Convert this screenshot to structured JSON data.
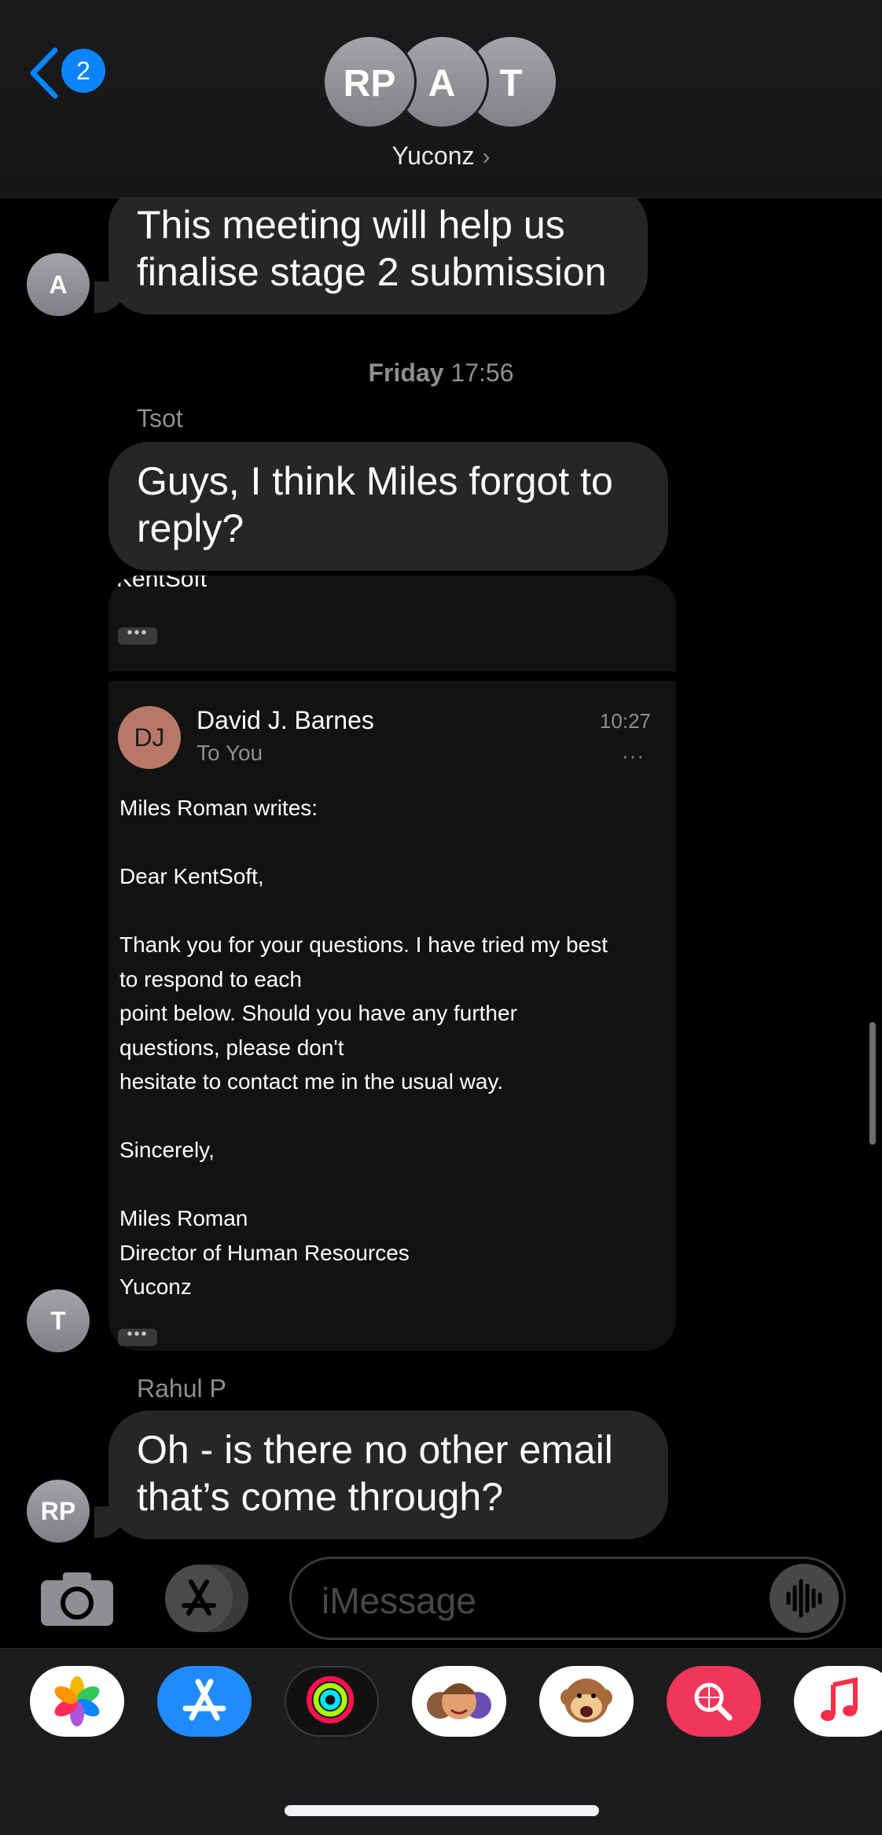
{
  "header": {
    "back_badge": "2",
    "avatars": [
      "RP",
      "A",
      "T"
    ],
    "group_name": "Yuconz",
    "chevron": "›"
  },
  "messages": {
    "first": {
      "avatar": "A",
      "line1": "This meeting will help us",
      "line2": "finalise stage 2 submission"
    },
    "timestamp": {
      "day": "Friday",
      "time": "17:56"
    },
    "tsot": {
      "sender": "Tsot",
      "line1": "Guys, I think Miles forgot to",
      "line2": "reply?"
    },
    "email_card": {
      "avatar": "T",
      "top_fragment": "KentSoft",
      "more_dots": "•••",
      "from_initials": "DJ",
      "from_name": "David J. Barnes",
      "to": "To You",
      "time": "10:27",
      "menu": "···",
      "body": {
        "l1": "Miles Roman writes:",
        "l2": "Dear KentSoft,",
        "l3": "Thank you for your questions. I have tried my best",
        "l4": "to respond to each",
        "l5": "point below. Should you have any further",
        "l6": "questions, please don't",
        "l7": "hesitate to contact me in the usual way.",
        "l8": "Sincerely,",
        "l9": "Miles Roman",
        "l10": "Director of Human Resources",
        "l11": "Yuconz"
      }
    },
    "rahul": {
      "sender": "Rahul P",
      "avatar": "RP",
      "line1": "Oh - is there no other email",
      "line2": "that’s come through?"
    }
  },
  "input": {
    "placeholder": "iMessage"
  },
  "apps": [
    "photos-icon",
    "app-store-icon",
    "activity-icon",
    "memoji-icon",
    "animoji-icon",
    "images-search-icon",
    "music-icon"
  ],
  "colors": {
    "accent": "#0a84ff",
    "bubble": "#262628",
    "background": "#000000"
  }
}
